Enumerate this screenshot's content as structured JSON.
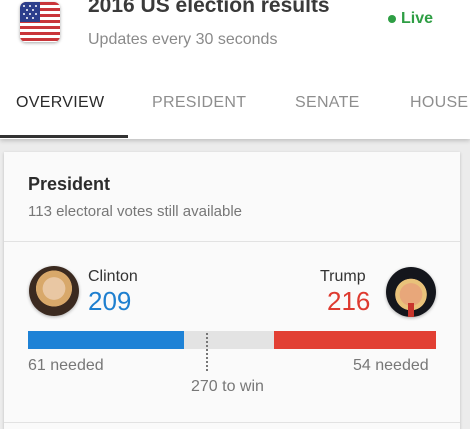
{
  "header": {
    "title": "2016 US election results",
    "subtitle": "Updates every 30 seconds",
    "live_label": "Live",
    "live_color": "#2e9e44",
    "flag_icon": "us-flag-icon"
  },
  "tabs": [
    {
      "label": "OVERVIEW",
      "active": true
    },
    {
      "label": "PRESIDENT",
      "active": false
    },
    {
      "label": "SENATE",
      "active": false
    },
    {
      "label": "HOUSE",
      "active": false
    }
  ],
  "president_card": {
    "title": "President",
    "subtitle": "113 electoral votes still available",
    "clinton": {
      "name": "Clinton",
      "votes": "209",
      "needed": "61 needed",
      "color": "#1e7fcf"
    },
    "trump": {
      "name": "Trump",
      "votes": "216",
      "needed": "54 needed",
      "color": "#de3a2f"
    },
    "to_win": "270 to win",
    "progress": {
      "total": 538,
      "dem": 209,
      "rep": 216
    }
  }
}
